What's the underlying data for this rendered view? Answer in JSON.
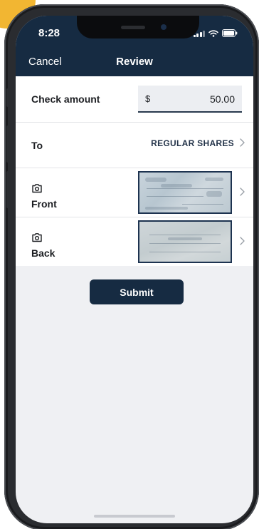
{
  "status_bar": {
    "time": "8:28",
    "icons": [
      "signal-icon",
      "wifi-icon",
      "battery-icon"
    ]
  },
  "nav": {
    "cancel_label": "Cancel",
    "title": "Review"
  },
  "form": {
    "amount": {
      "label": "Check amount",
      "currency_symbol": "$",
      "value": "50.00"
    },
    "to": {
      "label": "To",
      "account": "REGULAR SHARES"
    },
    "front": {
      "label": "Front",
      "icon": "camera-icon"
    },
    "back": {
      "label": "Back",
      "icon": "camera-icon"
    }
  },
  "submit_label": "Submit",
  "colors": {
    "header": "#162b42",
    "accent": "#f2b632",
    "background": "#eff0f3"
  }
}
